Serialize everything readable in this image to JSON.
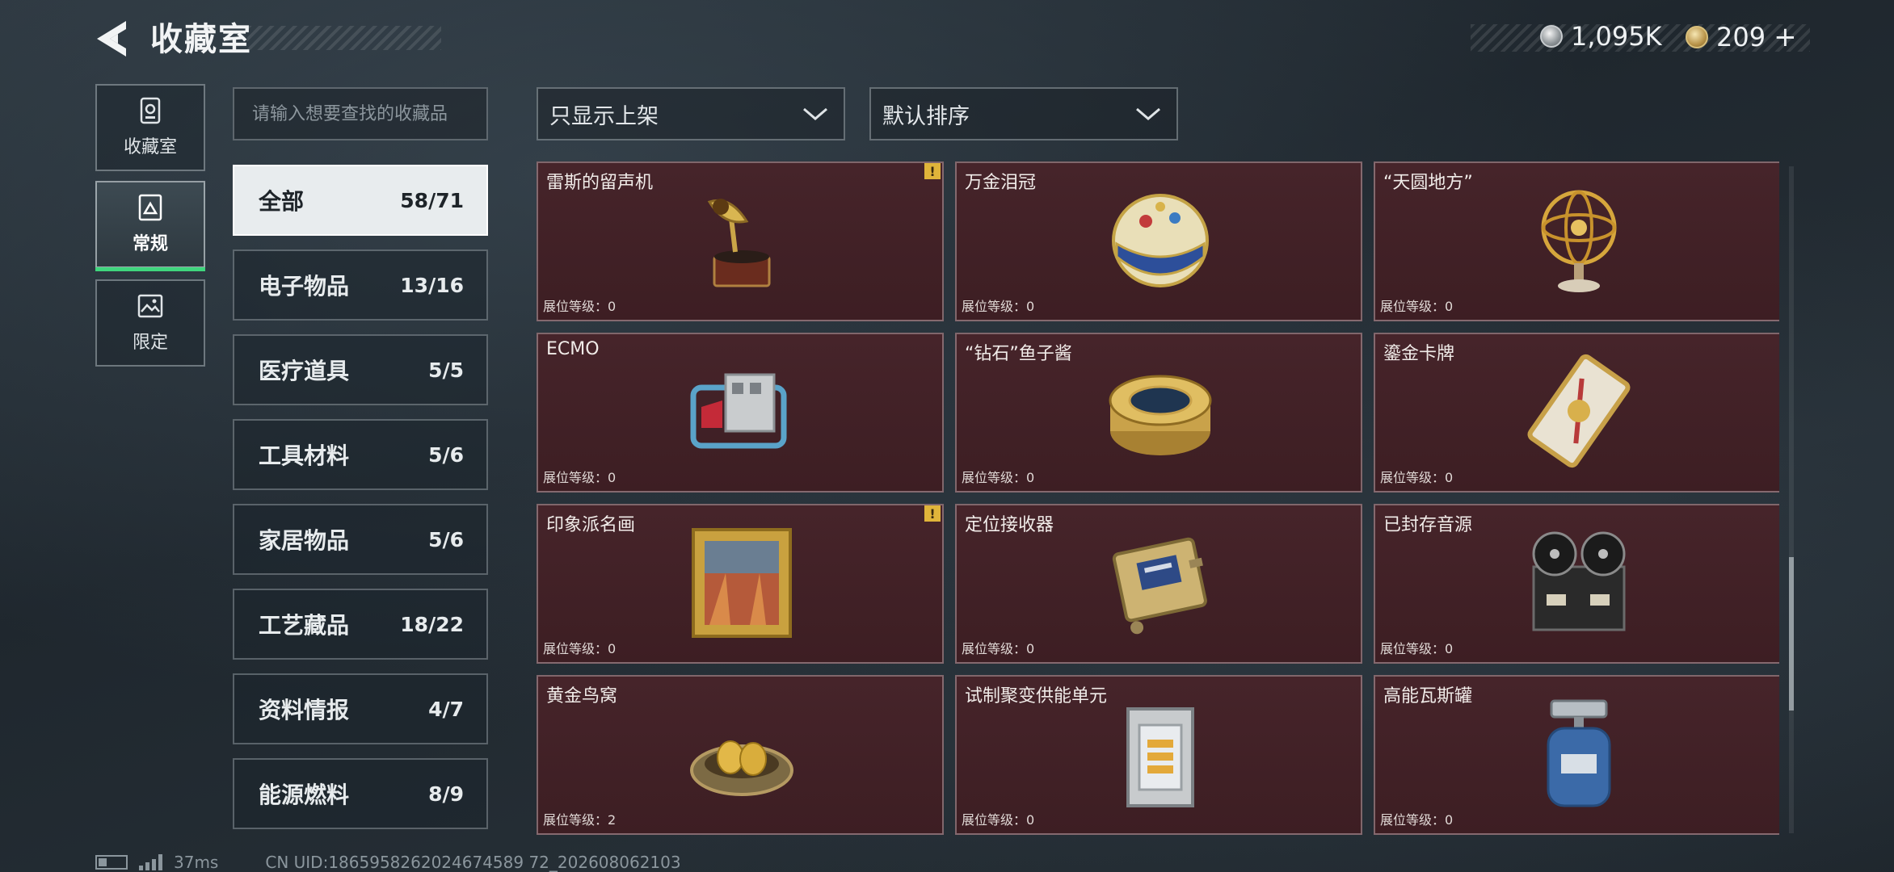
{
  "header": {
    "title": "收藏室",
    "currencies": [
      {
        "icon": "silver-coin-icon",
        "value": "1,095K"
      },
      {
        "icon": "gold-coin-icon",
        "value": "209"
      }
    ],
    "plus": "+"
  },
  "rail": [
    {
      "label": "收藏室",
      "icon": "collection-room-icon",
      "active": false
    },
    {
      "label": "常规",
      "icon": "regular-exhibit-icon",
      "active": true
    },
    {
      "label": "限定",
      "icon": "limited-picture-icon",
      "active": false
    }
  ],
  "search": {
    "placeholder": "请输入想要查找的收藏品",
    "value": ""
  },
  "filters": {
    "display": {
      "label": "只显示上架"
    },
    "sort": {
      "label": "默认排序"
    }
  },
  "categories": [
    {
      "name": "全部",
      "count": "58/71",
      "active": true
    },
    {
      "name": "电子物品",
      "count": "13/16",
      "active": false
    },
    {
      "name": "医疗道具",
      "count": "5/5",
      "active": false
    },
    {
      "name": "工具材料",
      "count": "5/6",
      "active": false
    },
    {
      "name": "家居物品",
      "count": "5/6",
      "active": false
    },
    {
      "name": "工艺藏品",
      "count": "18/22",
      "active": false
    },
    {
      "name": "资料情报",
      "count": "4/7",
      "active": false
    },
    {
      "name": "能源燃料",
      "count": "8/9",
      "active": false
    }
  ],
  "level_label": "展位等级：",
  "items": [
    {
      "name": "雷斯的留声机",
      "level": "0",
      "warning": "!"
    },
    {
      "name": "万金泪冠",
      "level": "0",
      "warning": ""
    },
    {
      "name": "“天圆地方”",
      "level": "0",
      "warning": ""
    },
    {
      "name": "ECMO",
      "level": "0",
      "warning": ""
    },
    {
      "name": "“钻石”鱼子酱",
      "level": "0",
      "warning": ""
    },
    {
      "name": "鎏金卡牌",
      "level": "0",
      "warning": ""
    },
    {
      "name": "印象派名画",
      "level": "0",
      "warning": "!"
    },
    {
      "name": "定位接收器",
      "level": "0",
      "warning": ""
    },
    {
      "name": "已封存音源",
      "level": "0",
      "warning": ""
    },
    {
      "name": "黄金鸟窝",
      "level": "2",
      "warning": ""
    },
    {
      "name": "试制聚变供能单元",
      "level": "0",
      "warning": ""
    },
    {
      "name": "高能瓦斯罐",
      "level": "0",
      "warning": ""
    }
  ],
  "footer": {
    "ping": "37ms",
    "uid": "CN UID:1865958262024674589 72_202608062103"
  }
}
